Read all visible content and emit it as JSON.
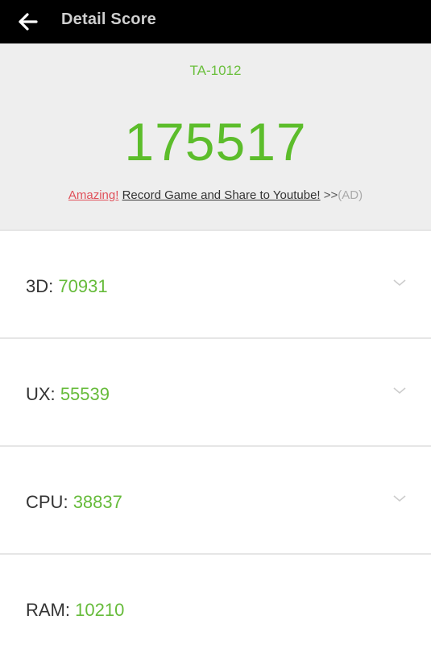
{
  "topbar": {
    "back_icon": "arrow-left-icon",
    "title": "Detail Score"
  },
  "header": {
    "device": "TA-1012",
    "total_score": "175517",
    "promo": {
      "amazing": "Amazing!",
      "record": "Record Game and Share to Youtube!",
      "arrows": ">>",
      "ad": "(AD)"
    }
  },
  "scores": [
    {
      "label": "3D:",
      "value": "70931",
      "expandable": true
    },
    {
      "label": "UX:",
      "value": "55539",
      "expandable": true
    },
    {
      "label": "CPU:",
      "value": "38837",
      "expandable": true
    },
    {
      "label": "RAM:",
      "value": "10210",
      "expandable": false
    }
  ],
  "colors": {
    "accent_green": "#5cbd2b",
    "promo_red": "#e0505a",
    "topbar_bg": "#000000",
    "header_bg": "#eeeeee"
  }
}
